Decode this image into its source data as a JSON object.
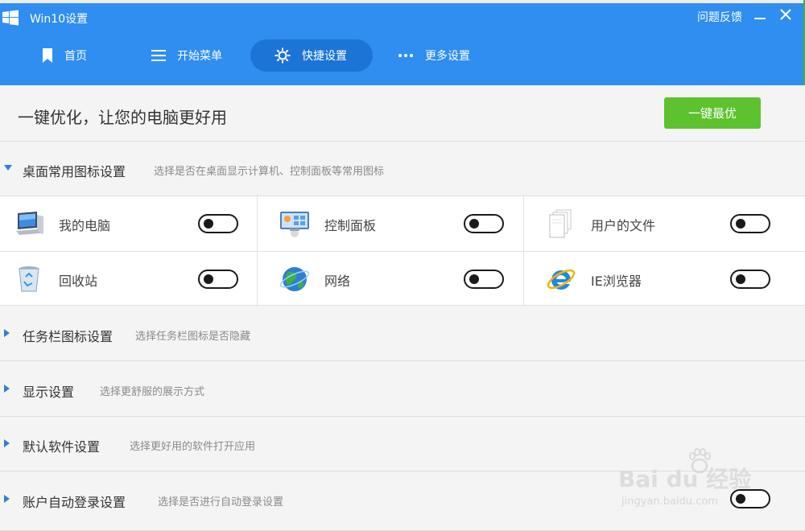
{
  "window": {
    "title": "Win10设置",
    "feedback": "问题反馈",
    "accent": "#2f8ef0",
    "active_tab_bg": "#1c74d6"
  },
  "nav": [
    {
      "label": "首页",
      "icon": "bookmark-icon"
    },
    {
      "label": "开始菜单",
      "icon": "menu-icon"
    },
    {
      "label": "快捷设置",
      "icon": "gear-icon",
      "active": true
    },
    {
      "label": "更多设置",
      "icon": "dots-icon"
    }
  ],
  "hero": {
    "text": "一键优化，让您的电脑更好用",
    "button": "一键最优",
    "button_color": "#5cc22e"
  },
  "sections": [
    {
      "title": "桌面常用图标设置",
      "desc": "选择是否在桌面显示计算机、控制面板等常用图标",
      "expanded": true
    },
    {
      "title": "任务栏图标设置",
      "desc": "选择任务栏图标是否隐藏",
      "expanded": false
    },
    {
      "title": "显示设置",
      "desc": "选择更舒服的展示方式",
      "expanded": false
    },
    {
      "title": "默认软件设置",
      "desc": "选择更好用的软件打开应用",
      "expanded": false
    },
    {
      "title": "账户自动登录设置",
      "desc": "选择是否进行自动登录设置",
      "expanded": false
    }
  ],
  "desktop_icons": [
    {
      "label": "我的电脑",
      "icon": "computer-icon",
      "enabled": false
    },
    {
      "label": "控制面板",
      "icon": "control-panel-icon",
      "enabled": false
    },
    {
      "label": "用户的文件",
      "icon": "documents-icon",
      "enabled": false
    },
    {
      "label": "回收站",
      "icon": "recycle-bin-icon",
      "enabled": false
    },
    {
      "label": "网络",
      "icon": "network-globe-icon",
      "enabled": false
    },
    {
      "label": "IE浏览器",
      "icon": "ie-browser-icon",
      "enabled": false
    }
  ],
  "watermark": {
    "brand": "Bai du 经验",
    "url": "jingyan.baidu.com"
  }
}
